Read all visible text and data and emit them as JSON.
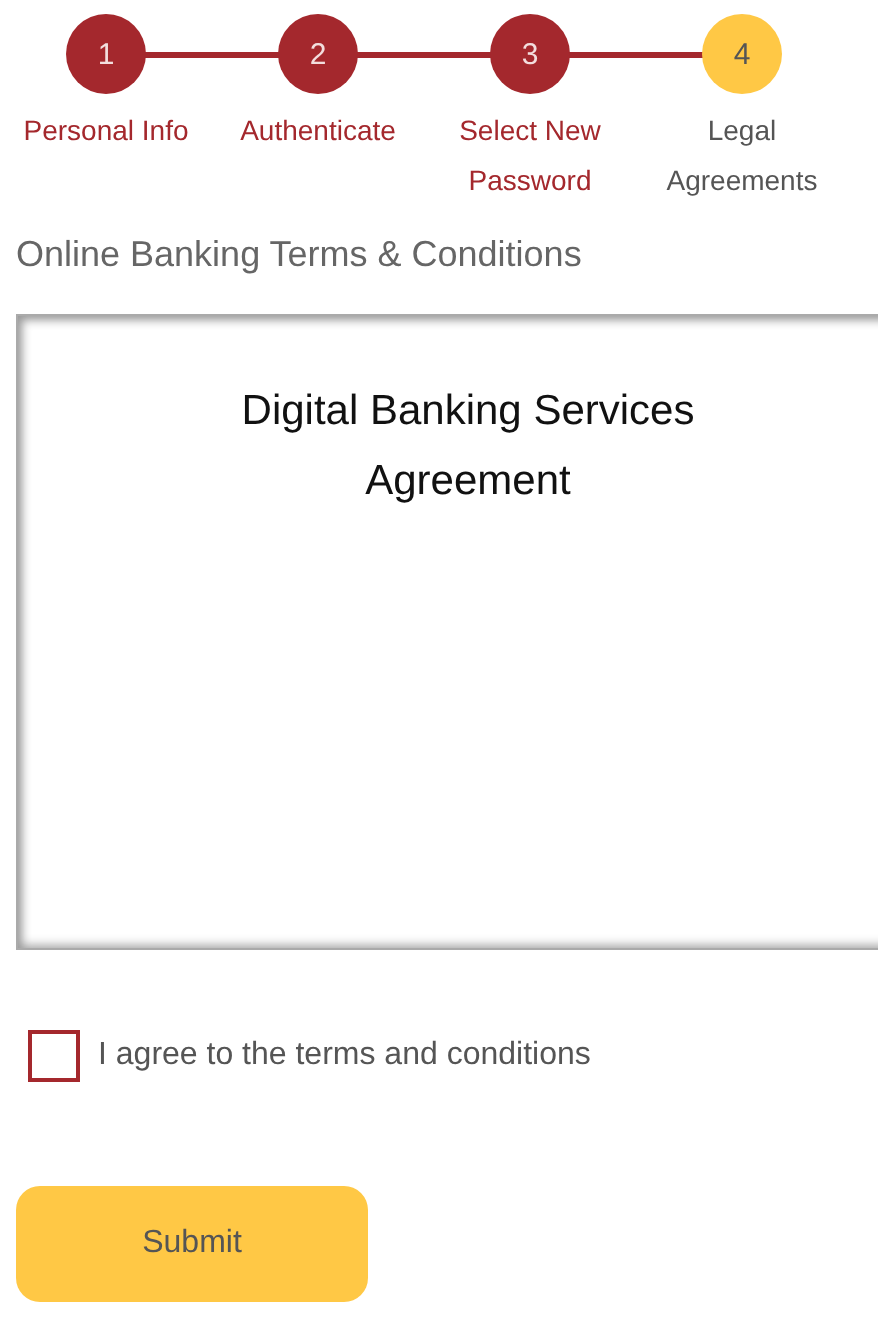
{
  "steps": [
    {
      "number": "1",
      "label": "Personal Info",
      "completed": true
    },
    {
      "number": "2",
      "label": "Authenticate",
      "completed": true
    },
    {
      "number": "3",
      "label": "Select New Password",
      "completed": true
    },
    {
      "number": "4",
      "label": "Legal Agreements",
      "completed": false
    }
  ],
  "section_title": "Online Banking Terms & Conditions",
  "document": {
    "title": "Digital Banking Services Agreement"
  },
  "agree_checkbox": {
    "label": "I agree to the terms and conditions",
    "checked": false
  },
  "submit_button": {
    "label": "Submit"
  }
}
